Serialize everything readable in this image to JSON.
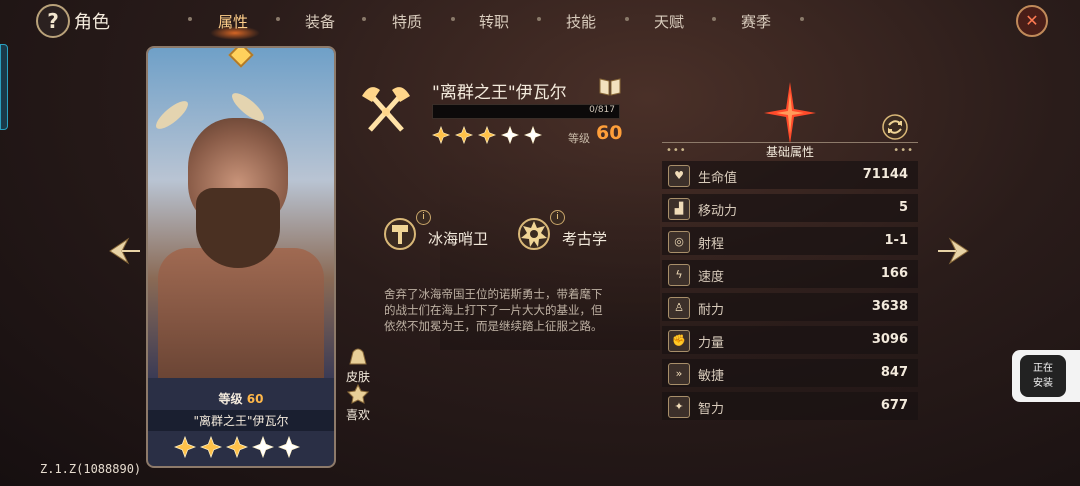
{
  "header": {
    "back_icon_glyph": "?",
    "title": "角色",
    "tabs": [
      {
        "label": "属性",
        "active": true
      },
      {
        "label": "装备"
      },
      {
        "label": "特质"
      },
      {
        "label": "转职"
      },
      {
        "label": "技能"
      },
      {
        "label": "天赋"
      },
      {
        "label": "赛季"
      }
    ],
    "close_glyph": "✕"
  },
  "card": {
    "level_label": "等级",
    "level_value": "60",
    "name": "\"离群之王\"伊瓦尔",
    "stars": 5
  },
  "side_buttons": {
    "skin_label": "皮肤",
    "like_label": "喜欢"
  },
  "hero": {
    "title": "\"离群之王\"伊瓦尔",
    "xp_text": "0/817",
    "xp_fraction": 0,
    "stars": 5,
    "level_label": "等级",
    "level_value": "60",
    "traits": [
      {
        "label": "冰海哨卫",
        "icon": "hammer-emblem-icon"
      },
      {
        "label": "考古学",
        "icon": "gear-emblem-icon"
      }
    ],
    "info_glyph": "i",
    "description": "舍弃了冰海帝国王位的诺斯勇士，带着麾下的战士们在海上打下了一片大大的基业，但依然不加冕为王，而是继续踏上征服之路。"
  },
  "stats": {
    "title": "基础属性",
    "dots": "•••",
    "rows": [
      {
        "name": "生命值",
        "value": "71144",
        "icon": "heart-icon",
        "glyph": "♥"
      },
      {
        "name": "移动力",
        "value": "5",
        "icon": "boot-icon",
        "glyph": "👢"
      },
      {
        "name": "射程",
        "value": "1-1",
        "icon": "target-icon",
        "glyph": "◎"
      },
      {
        "name": "速度",
        "value": "166",
        "icon": "lightning-icon",
        "glyph": "ϟ"
      },
      {
        "name": "耐力",
        "value": "3638",
        "icon": "person-icon",
        "glyph": "♙"
      },
      {
        "name": "力量",
        "value": "3096",
        "icon": "arm-icon",
        "glyph": "💪"
      },
      {
        "name": "敏捷",
        "value": "847",
        "icon": "wing-icon",
        "glyph": "»"
      },
      {
        "name": "智力",
        "value": "677",
        "icon": "star-burst-icon",
        "glyph": "✦"
      }
    ]
  },
  "install_popup": {
    "line1": "正在",
    "line2": "安装"
  },
  "version": "Z.1.Z(1088890)",
  "colors": {
    "accent_orange": "#ff9f3a",
    "star_gold": "#ffc24a",
    "active_tab": "#ffcf8a"
  }
}
